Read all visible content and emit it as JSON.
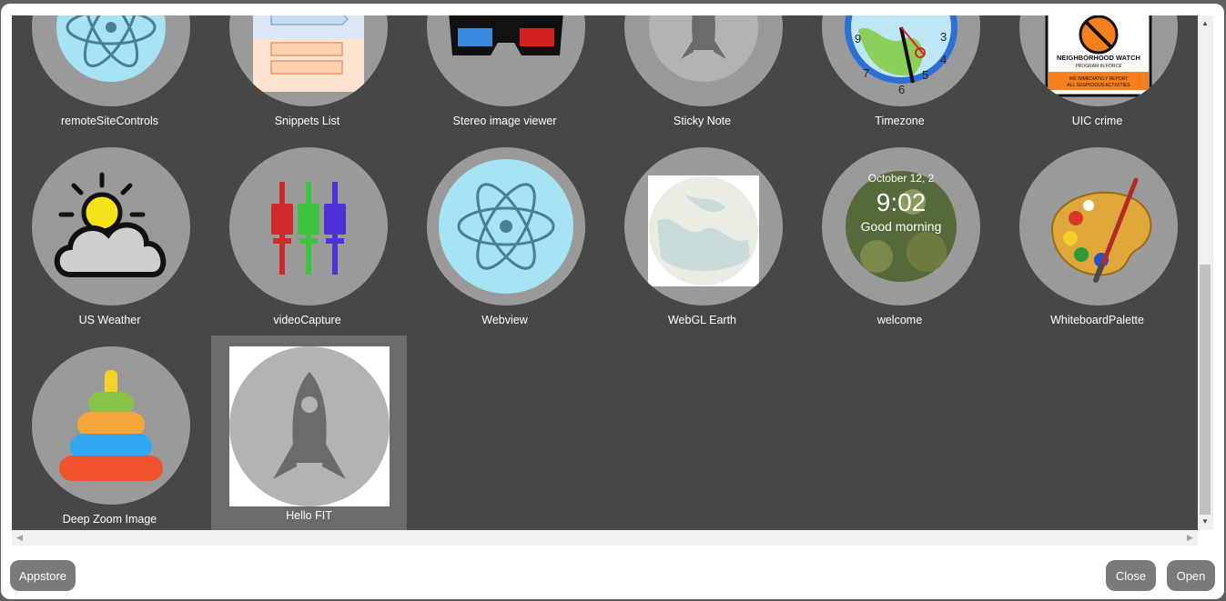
{
  "apps": [
    {
      "label": "remoteSiteControls",
      "icon": "electron-atom-icon"
    },
    {
      "label": "Snippets List",
      "icon": "snippets-list-icon"
    },
    {
      "label": "Stereo image viewer",
      "icon": "3d-glasses-icon"
    },
    {
      "label": "Sticky Note",
      "icon": "rocket-icon"
    },
    {
      "label": "Timezone",
      "icon": "clock-icon",
      "clock_numbers": [
        "9",
        "7",
        "6",
        "5",
        "4",
        "3"
      ]
    },
    {
      "label": "UIC crime",
      "icon": "neighborhood-watch-icon",
      "sign_title": "NEIGHBORHOOD WATCH",
      "sign_sub": "PROGRAM IN FORCE",
      "sign_bottom1": "WE IMMEDIATELY REPORT",
      "sign_bottom2": "ALL SUSPICIOUS ACTIVITIES"
    },
    {
      "label": "US Weather",
      "icon": "weather-sun-cloud-icon"
    },
    {
      "label": "videoCapture",
      "icon": "mixer-sliders-icon"
    },
    {
      "label": "Webview",
      "icon": "electron-atom-icon"
    },
    {
      "label": "WebGL Earth",
      "icon": "globe-map-icon"
    },
    {
      "label": "welcome",
      "icon": "welcome-screen-icon",
      "date_text": "October 12, 2",
      "time_text": "9:02",
      "greeting": "Good morning"
    },
    {
      "label": "WhiteboardPalette",
      "icon": "paint-palette-icon"
    },
    {
      "label": "Deep Zoom Image",
      "icon": "ring-stack-toy-icon"
    },
    {
      "label": "Hello FIT",
      "icon": "rocket-icon",
      "selected": true
    }
  ],
  "footer": {
    "appstore_label": "Appstore",
    "close_label": "Close",
    "open_label": "Open"
  },
  "colors": {
    "grid_bg": "#474747",
    "icon_disc": "#9a9a9a",
    "selected_tile": "#6b6b6b",
    "button_bg": "#7a7a7a"
  }
}
